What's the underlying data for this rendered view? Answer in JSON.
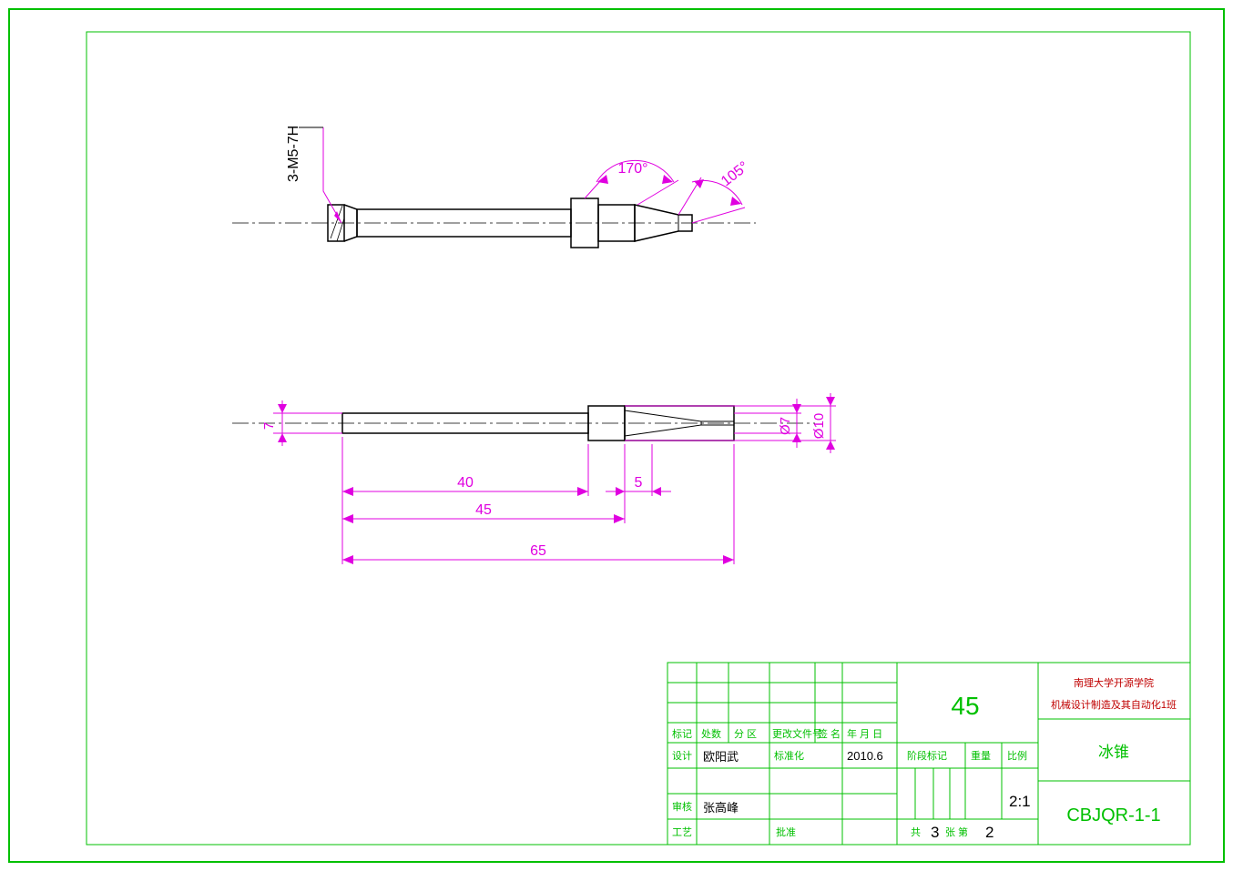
{
  "callout_top": "3-M5-7H",
  "angles": {
    "a1": "170°",
    "a2": "105°"
  },
  "dims": {
    "d7_left": "7",
    "d7_right": "Ø7",
    "d10": "Ø10",
    "l40": "40",
    "l45": "45",
    "l65": "65",
    "l5": "5"
  },
  "tb": {
    "headers": {
      "h1": "标记",
      "h2": "处数",
      "h3": "分 区",
      "h4": "更改文件号",
      "h5": "签 名",
      "h6": "年 月 日"
    },
    "rows": {
      "r1_label": "设计",
      "r1_name": "欧阳武",
      "r1_std": "标准化",
      "r1_date": "2010.6",
      "r2_label": "审核",
      "r2_name": "张高峰",
      "r3_label": "工艺",
      "r3_appr": "批准"
    },
    "material": "45",
    "school": "南理大学开源学院",
    "dept": "机械设计制造及其自动化1班",
    "stage_label": "阶段标记",
    "weight_label": "重量",
    "scale_label": "比例",
    "scale": "2:1",
    "part_name": "冰锥",
    "sheet_prefix": "共",
    "sheet_mid": "张 第",
    "sheet_n1": "3",
    "sheet_n2": "2",
    "drawing_no": "CBJQR-1-1"
  }
}
